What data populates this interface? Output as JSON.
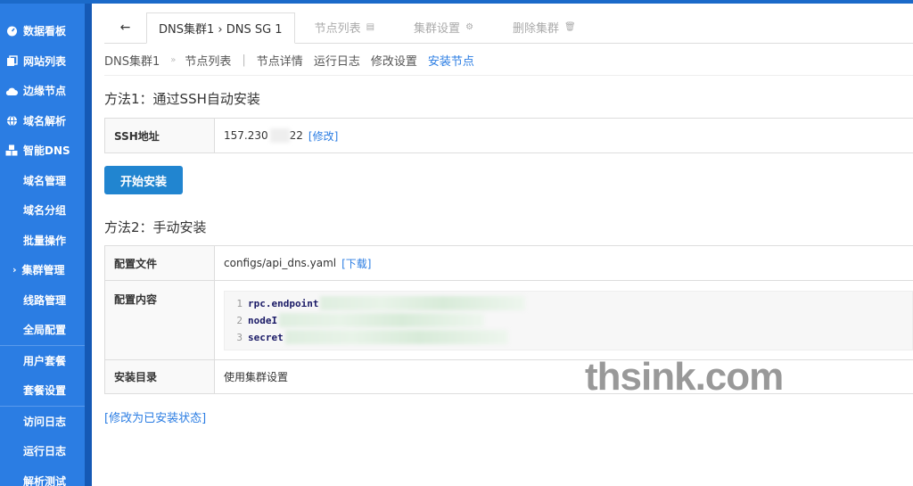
{
  "sidebar": {
    "items": [
      {
        "label": "数据看板",
        "icon": "dashboard-icon"
      },
      {
        "label": "网站列表",
        "icon": "copy-icon"
      },
      {
        "label": "边缘节点",
        "icon": "cloud-icon"
      },
      {
        "label": "域名解析",
        "icon": "globe-icon"
      },
      {
        "label": "智能DNS",
        "icon": "cubes-icon"
      }
    ],
    "sub_items": [
      "域名管理",
      "域名分组",
      "批量操作"
    ],
    "cluster_item": "集群管理",
    "more_items": [
      "线路管理",
      "全局配置"
    ],
    "group2": [
      "用户套餐",
      "套餐设置"
    ],
    "group3": [
      "访问日志",
      "运行日志",
      "解析测试"
    ]
  },
  "tabs": {
    "back": "←",
    "active": "DNS集群1 › DNS SG 1",
    "nodes": "节点列表",
    "settings": "集群设置",
    "delete": "删除集群"
  },
  "crumbs": {
    "cluster": "DNS集群1",
    "node_list": "节点列表",
    "detail": "节点详情",
    "logs": "运行日志",
    "edit": "修改设置",
    "install": "安装节点"
  },
  "method1": {
    "title": "方法1：通过SSH自动安装",
    "ssh_label": "SSH地址",
    "ssh_prefix": "157.230",
    "ssh_suffix": "22",
    "edit_link": "[修改]",
    "button": "开始安装"
  },
  "method2": {
    "title": "方法2：手动安装",
    "config_file_label": "配置文件",
    "config_file": "configs/api_dns.yaml",
    "download_link": "[下载]",
    "config_content_label": "配置内容",
    "code_lines": [
      {
        "n": "1",
        "text": "rpc.endpoint"
      },
      {
        "n": "2",
        "text": "nodeI"
      },
      {
        "n": "3",
        "text": "secret"
      }
    ],
    "install_dir_label": "安装目录",
    "install_dir": "使用集群设置"
  },
  "footer_link": "[修改为已安装状态]",
  "watermark": "thsink.com"
}
